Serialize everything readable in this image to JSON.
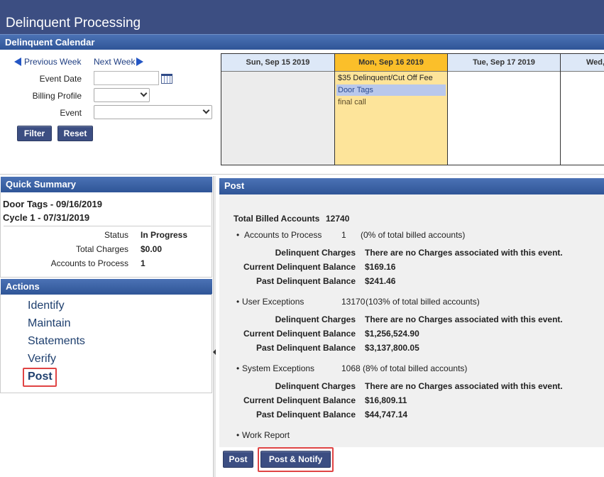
{
  "header": {
    "title": "Delinquent Processing"
  },
  "calendar_bar": {
    "title": "Delinquent Calendar"
  },
  "filters": {
    "prev_week": "Previous Week",
    "next_week": "Next Week",
    "event_date_label": "Event Date",
    "event_date_value": "",
    "billing_profile_label": "Billing Profile",
    "billing_profile_value": "",
    "event_label": "Event",
    "event_value": "",
    "filter_button": "Filter",
    "reset_button": "Reset"
  },
  "calendar": {
    "days": [
      {
        "label": "Sun, Sep 15 2019",
        "events": []
      },
      {
        "label": "Mon, Sep 16 2019",
        "events": [
          "$35 Delinquent/Cut Off Fee",
          "Door Tags",
          "final call"
        ]
      },
      {
        "label": "Tue, Sep 17 2019",
        "events": []
      },
      {
        "label": "Wed,",
        "events": []
      }
    ],
    "colors": {
      "today_header": "#fbbf2a",
      "today_body": "#fde49a",
      "selected_event": "#b9c8ec",
      "past_body": "#ececec",
      "header_default": "#dde8f7"
    }
  },
  "quick_summary": {
    "title": "Quick Summary",
    "line1": "Door Tags - 09/16/2019",
    "line2": "Cycle 1 - 07/31/2019",
    "status_label": "Status",
    "status_value": "In Progress",
    "charges_label": "Total Charges",
    "charges_value": "$0.00",
    "accounts_label": "Accounts to Process",
    "accounts_value": "1"
  },
  "actions": {
    "title": "Actions",
    "items": [
      "Identify",
      "Maintain",
      "Statements",
      "Verify",
      "Post"
    ],
    "active": "Post"
  },
  "post": {
    "title": "Post",
    "total_label": "Total Billed Accounts",
    "total_value": "12740",
    "sections": [
      {
        "label": "Accounts to Process",
        "count": "1",
        "pct": "(0% of total billed accounts)",
        "delinquent_charges_label": "Delinquent Charges",
        "delinquent_charges_value": "There are no Charges associated with this event.",
        "current_balance_label": "Current Delinquent Balance",
        "current_balance_value": "$169.16",
        "past_balance_label": "Past Delinquent Balance",
        "past_balance_value": "$241.46"
      },
      {
        "label": "User Exceptions",
        "count": "13170",
        "pct": "(103% of total billed accounts)",
        "delinquent_charges_label": "Delinquent Charges",
        "delinquent_charges_value": "There are no Charges associated with this event.",
        "current_balance_label": "Current Delinquent Balance",
        "current_balance_value": "$1,256,524.90",
        "past_balance_label": "Past Delinquent Balance",
        "past_balance_value": "$3,137,800.05"
      },
      {
        "label": "System Exceptions",
        "count": "1068",
        "pct": "(8% of total billed accounts)",
        "delinquent_charges_label": "Delinquent Charges",
        "delinquent_charges_value": "There are no Charges associated with this event.",
        "current_balance_label": "Current Delinquent Balance",
        "current_balance_value": "$16,809.11",
        "past_balance_label": "Past Delinquent Balance",
        "past_balance_value": "$44,747.14"
      }
    ],
    "work_report": "Work Report",
    "post_button": "Post",
    "post_notify_button": "Post & Notify"
  },
  "colors": {
    "header_bg": "#3c4e82",
    "panel_head": "#3a62a8",
    "highlight": "#e04444",
    "link": "#1e3f6e"
  }
}
